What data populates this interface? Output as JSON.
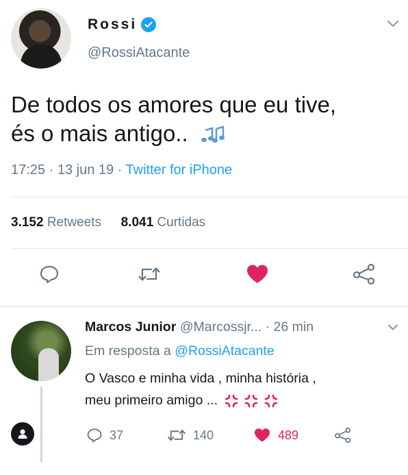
{
  "tweet": {
    "display_name": "Rossi",
    "handle": "@RossiAtacante",
    "text_line1": "De todos os amores que eu tive,",
    "text_line2": "és o mais antigo..",
    "time": "17:25 · 13 jun 19 · ",
    "source": "Twitter for iPhone",
    "retweets_count": "3.152",
    "retweets_label": "Retweets",
    "likes_count": "8.041",
    "likes_label": "Curtidas",
    "icons": [
      "verified-badge-icon",
      "chevron-down-icon",
      "musical-notes-icon",
      "reply-icon",
      "retweet-icon",
      "heart-icon",
      "share-icon"
    ],
    "colors": {
      "accent": "#1da1f2",
      "like": "#e0245e",
      "muted": "#657786"
    }
  },
  "reply": {
    "display_name": "Marcos Junior",
    "handle": "@Marcossjr...",
    "time": "· 26 min",
    "in_reply_prefix": "Em resposta a",
    "in_reply_mention": "@RossiAtacante",
    "text_line1": "O Vasco e minha vida , minha história ,",
    "text_line2": "meu primeiro amigo ...",
    "reply_count": "37",
    "retweet_count": "140",
    "like_count": "489",
    "icons": [
      "anger-symbol-icon",
      "reply-icon",
      "retweet-icon",
      "heart-icon",
      "share-icon",
      "user-icon"
    ]
  }
}
